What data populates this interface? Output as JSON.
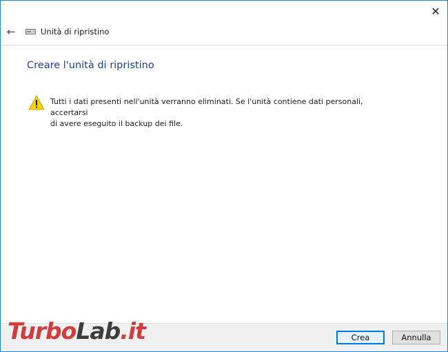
{
  "window": {
    "title": "Unità di ripristino",
    "close_glyph": "✕",
    "back_glyph": "←"
  },
  "content": {
    "heading": "Creare l'unità di ripristino",
    "warning_line1": "Tutti i dati presenti nell'unità verranno eliminati. Se l'unità contiene dati personali, accertarsi",
    "warning_line2": "di avere eseguito il backup dei file."
  },
  "buttons": {
    "create": "Crea",
    "cancel": "Annulla"
  },
  "watermark": {
    "part1": "Turbo",
    "part2": "Lab",
    "part3": ".it"
  },
  "colors": {
    "accent": "#1f3d99",
    "window_border": "#1883d7",
    "warning_yellow": "#f7d117"
  }
}
